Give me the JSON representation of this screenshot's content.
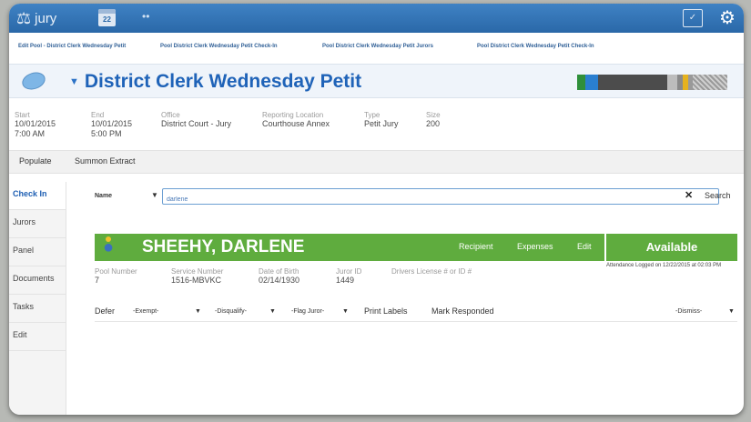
{
  "app": {
    "name": "jury",
    "calendar_day": "22"
  },
  "breadcrumbs": [
    "Edit Pool - District Clerk Wednesday Petit",
    "Pool District Clerk Wednesday Petit Check-In",
    "Pool District Clerk Wednesday Petit Jurors",
    "Pool District Clerk Wednesday Petit Check-In"
  ],
  "pool": {
    "title": "District Clerk Wednesday Petit",
    "fields": [
      {
        "label": "Start",
        "value": "10/01/2015",
        "value2": "7:00 AM"
      },
      {
        "label": "End",
        "value": "10/01/2015",
        "value2": "5:00 PM"
      },
      {
        "label": "Office",
        "value": "District Court - Jury",
        "value2": ""
      },
      {
        "label": "Reporting Location",
        "value": "Courthouse Annex",
        "value2": ""
      },
      {
        "label": "Type",
        "value": "Petit Jury",
        "value2": ""
      },
      {
        "label": "Size",
        "value": "200",
        "value2": ""
      }
    ],
    "actions": [
      "Populate",
      "Summon Extract"
    ]
  },
  "sidenav": {
    "items": [
      {
        "label": "Check In"
      },
      {
        "label": "Jurors"
      },
      {
        "label": "Panel"
      },
      {
        "label": "Documents"
      },
      {
        "label": "Tasks"
      },
      {
        "label": "Edit"
      }
    ]
  },
  "search": {
    "field_label": "Name",
    "value": "darlene",
    "button": "Search"
  },
  "juror": {
    "name": "SHEEHY, DARLENE",
    "links": [
      "Recipient",
      "Expenses",
      "Edit"
    ],
    "status": "Available",
    "attendance_note": "Attendance Logged on 12/22/2015 at 02:03 PM",
    "details": [
      {
        "label": "Pool Number",
        "value": "7"
      },
      {
        "label": "Service Number",
        "value": "1516-MBVKC"
      },
      {
        "label": "Date of Birth",
        "value": "02/14/1930"
      },
      {
        "label": "Juror ID",
        "value": "1449"
      },
      {
        "label": "Drivers License # or ID #",
        "value": ""
      }
    ]
  },
  "juror_actions": {
    "defer": "Defer",
    "exempt": "-Exempt-",
    "disqualify": "-Disqualify-",
    "flag": "-Flag Juror-",
    "print_labels": "Print Labels",
    "mark_responded": "Mark Responded",
    "dismiss": "-Dismiss-"
  },
  "colors": {
    "accent_blue": "#2a68a8",
    "title_blue": "#1f63b8",
    "juror_green": "#5fac3e"
  }
}
